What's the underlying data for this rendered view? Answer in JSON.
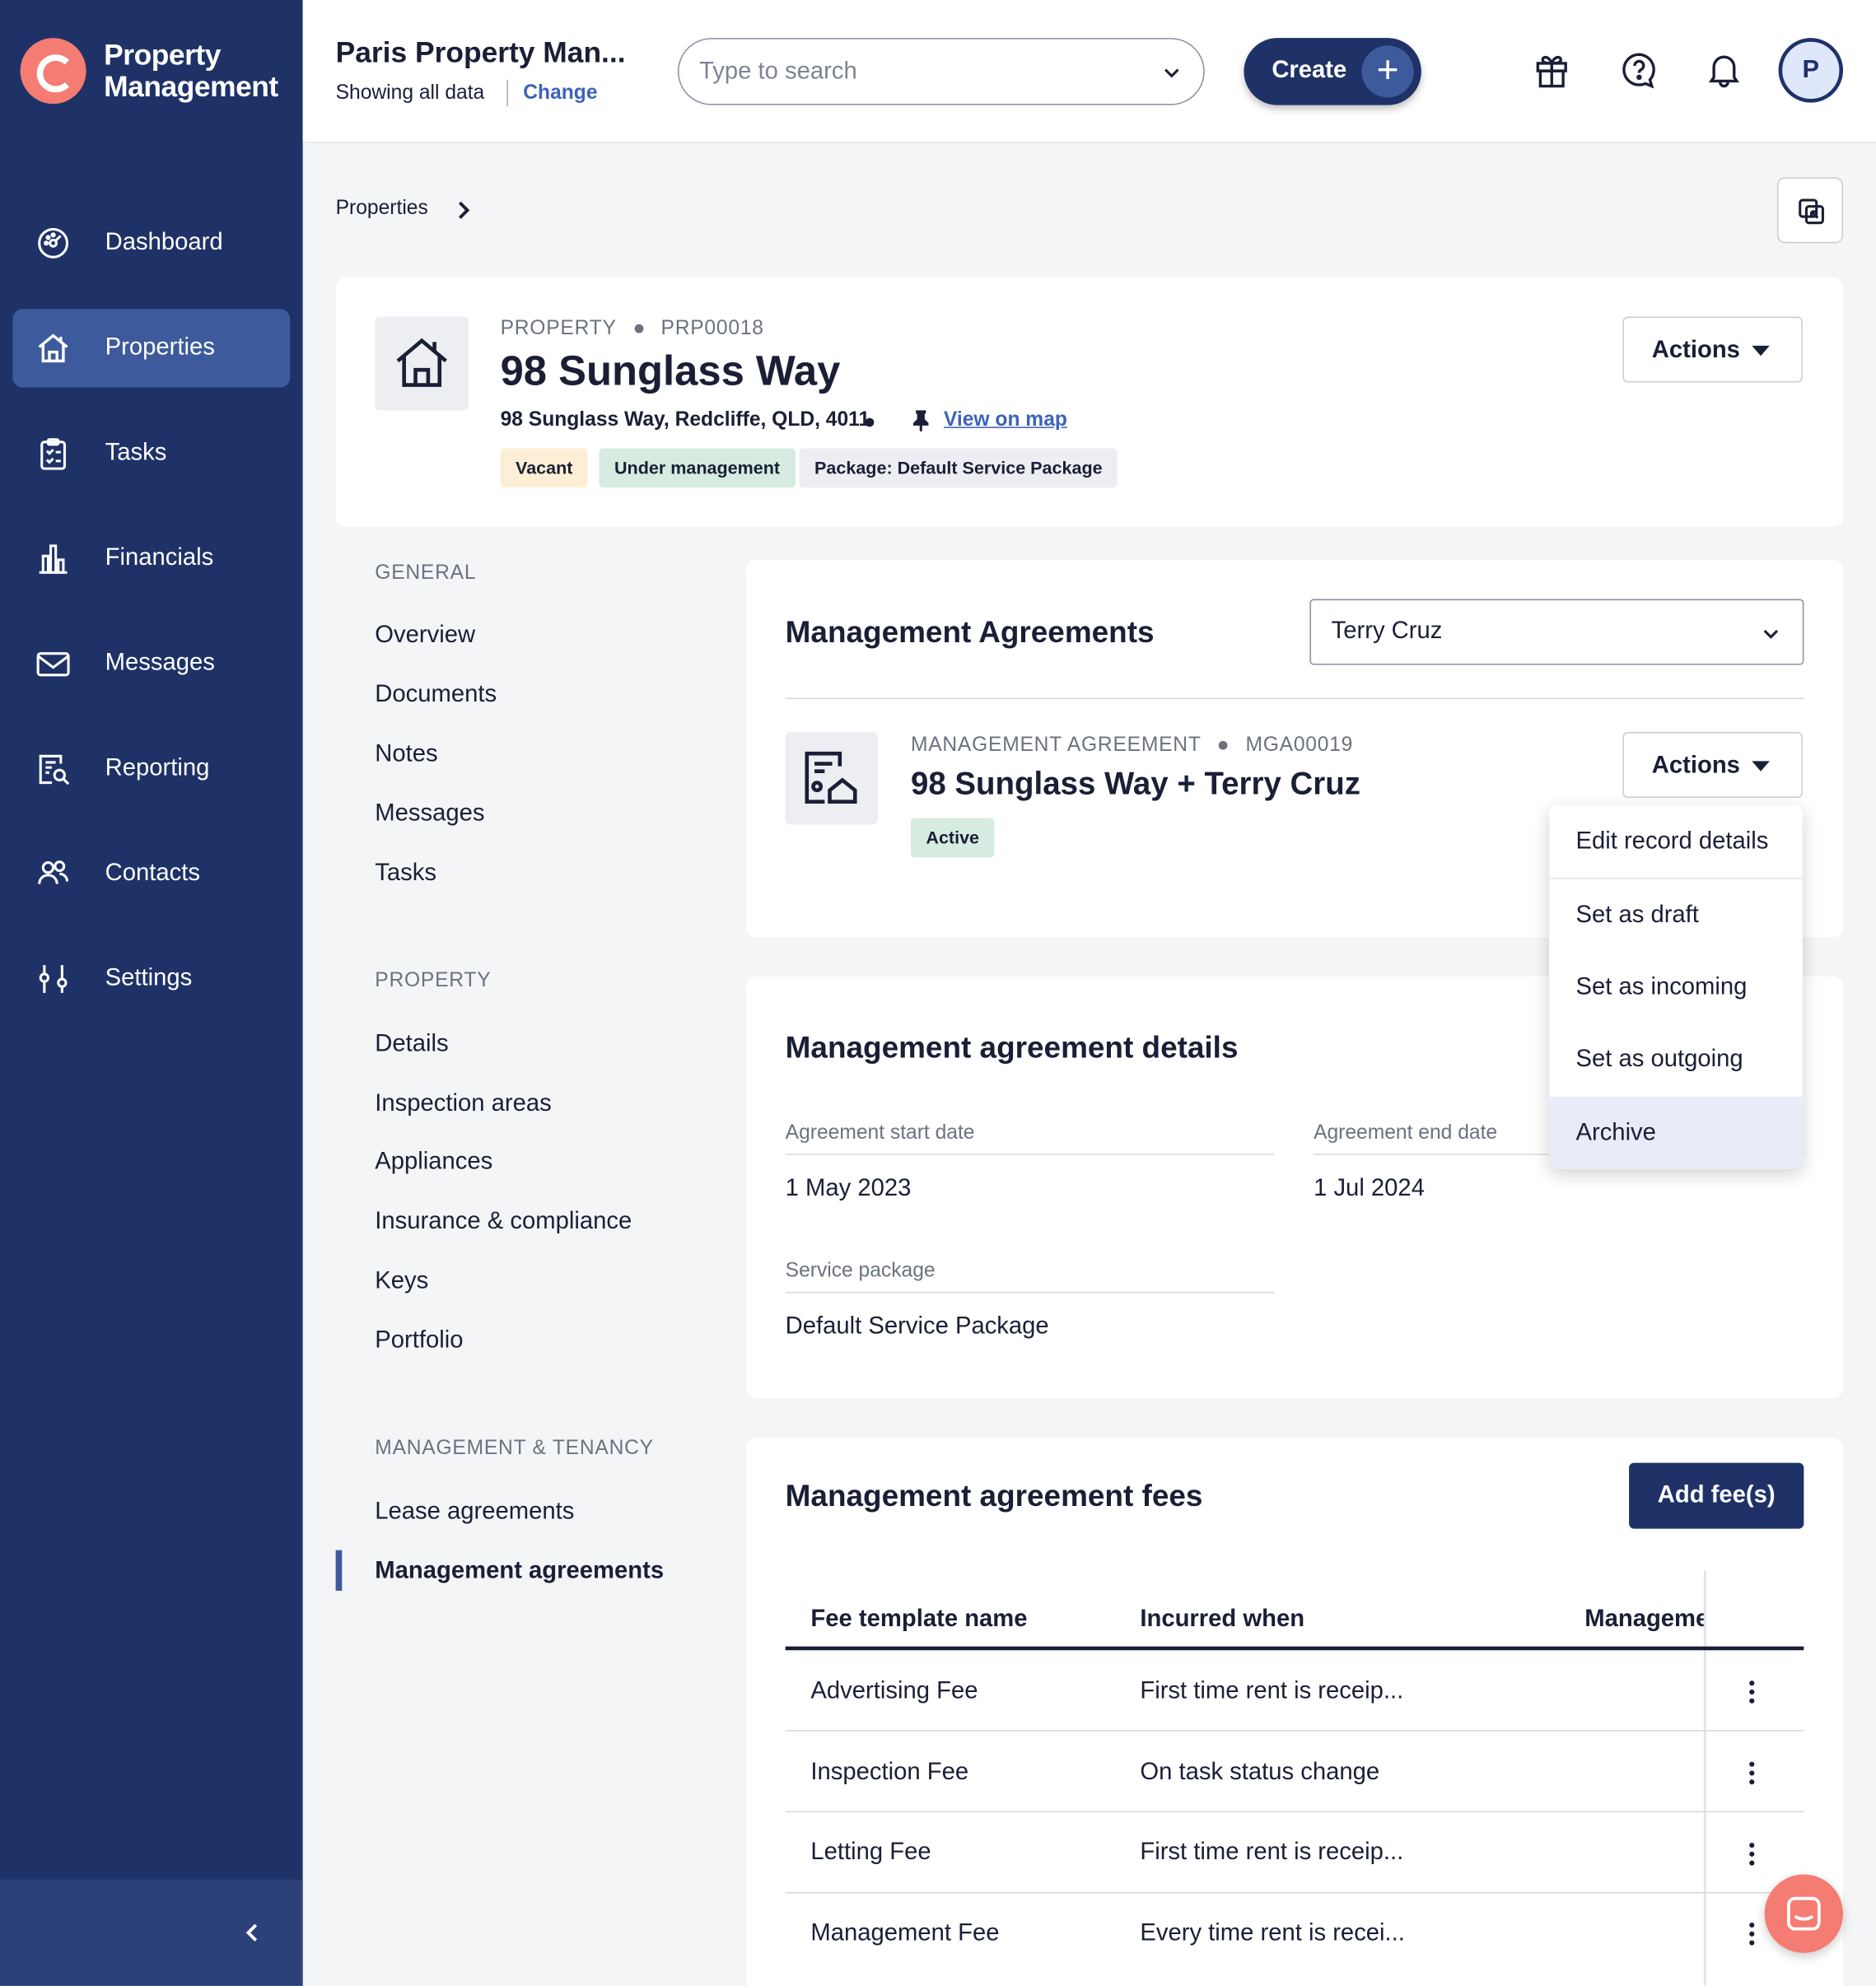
{
  "app": {
    "name_line1": "Property",
    "name_line2": "Management"
  },
  "sidebar": {
    "items": [
      {
        "label": "Dashboard",
        "icon": "dashboard-icon"
      },
      {
        "label": "Properties",
        "icon": "house-icon",
        "active": true
      },
      {
        "label": "Tasks",
        "icon": "clipboard-icon"
      },
      {
        "label": "Financials",
        "icon": "bar-chart-icon"
      },
      {
        "label": "Messages",
        "icon": "envelope-icon"
      },
      {
        "label": "Reporting",
        "icon": "report-search-icon"
      },
      {
        "label": "Contacts",
        "icon": "people-icon"
      },
      {
        "label": "Settings",
        "icon": "sliders-icon"
      }
    ]
  },
  "header": {
    "company": "Paris Property Man...",
    "showing": "Showing all data",
    "change": "Change",
    "search_placeholder": "Type to search",
    "create_label": "Create",
    "avatar_initial": "P"
  },
  "breadcrumb": {
    "root": "Properties"
  },
  "property": {
    "eyebrow_type": "PROPERTY",
    "eyebrow_id": "PRP00018",
    "title": "98 Sunglass Way",
    "address": "98 Sunglass Way, Redcliffe, QLD, 4011",
    "map_link": "View on map",
    "tags": [
      "Vacant",
      "Under management",
      "Package: Default Service Package"
    ],
    "actions_label": "Actions"
  },
  "subnav": {
    "general_heading": "GENERAL",
    "general": [
      "Overview",
      "Documents",
      "Notes",
      "Messages",
      "Tasks"
    ],
    "property_heading": "PROPERTY",
    "property": [
      "Details",
      "Inspection areas",
      "Appliances",
      "Insurance & compliance",
      "Keys",
      "Portfolio"
    ],
    "mgmt_heading": "MANAGEMENT & TENANCY",
    "mgmt": [
      "Lease agreements",
      "Management agreements"
    ]
  },
  "agreements": {
    "title": "Management Agreements",
    "owner_select": "Terry Cruz",
    "eyebrow_type": "MANAGEMENT AGREEMENT",
    "eyebrow_id": "MGA00019",
    "name": "98 Sunglass Way + Terry Cruz",
    "status": "Active",
    "actions_label": "Actions",
    "menu": [
      "Edit record details",
      "Set as draft",
      "Set as incoming",
      "Set as outgoing",
      "Archive"
    ]
  },
  "details": {
    "title": "Management agreement details",
    "start_label": "Agreement start date",
    "start_value": "1 May 2023",
    "end_label": "Agreement end date",
    "end_value": "1 Jul 2024",
    "package_label": "Service package",
    "package_value": "Default Service Package"
  },
  "fees": {
    "title": "Management agreement fees",
    "add_label": "Add fee(s)",
    "columns": [
      "Fee template name",
      "Incurred when",
      "Manageme"
    ],
    "rows": [
      {
        "name": "Advertising Fee",
        "when": "First time rent is receip..."
      },
      {
        "name": "Inspection Fee",
        "when": "On task status change"
      },
      {
        "name": "Letting Fee",
        "when": "First time rent is receip..."
      },
      {
        "name": "Management Fee",
        "when": "Every time rent is recei..."
      }
    ]
  },
  "colors": {
    "sidebar": "#1e3267",
    "accent": "#3d62b8",
    "brand": "#f47c73"
  }
}
